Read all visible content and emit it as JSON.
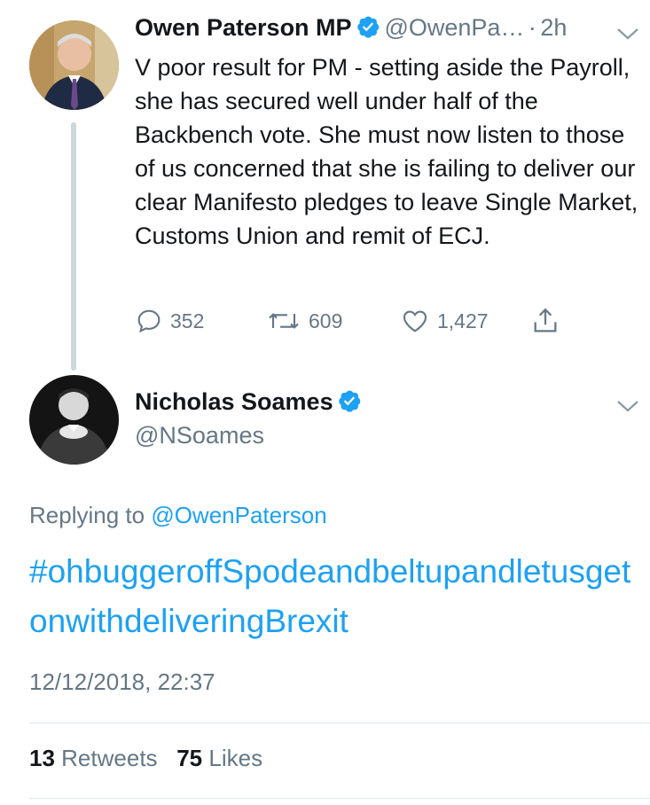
{
  "parent_tweet": {
    "author_name": "Owen Paterson MP",
    "handle": "@OwenPa…",
    "time_sep": "·",
    "time": "2h",
    "text": "V poor result for PM - setting aside the Payroll, she has secured well under half of the Backbench vote. She must now listen to those of us concerned that she is failing to deliver our clear Manifesto pledges to leave Single Market, Customs Union and remit of ECJ.",
    "replies": "352",
    "retweets": "609",
    "likes": "1,427"
  },
  "main_tweet": {
    "author_name": "Nicholas Soames",
    "handle": "@NSoames",
    "replying_prefix": "Replying to",
    "replying_to": "@OwenPaterson",
    "text": "#ohbuggeroffSpodeandbeltupandletusgetonwithdeliveringBrexit",
    "timestamp": "12/12/2018, 22:37",
    "retweet_count": "13",
    "retweet_label": "Retweets",
    "like_count": "75",
    "like_label": "Likes"
  },
  "colors": {
    "link": "#1da1f2",
    "secondary": "#657786",
    "divider": "#e1e8ed",
    "thread_line": "#ccd6dd"
  }
}
